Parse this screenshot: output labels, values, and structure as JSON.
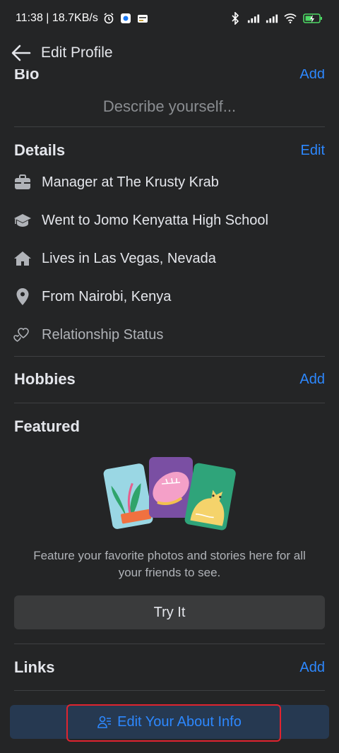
{
  "status_bar": {
    "time_info": "11:38 | 18.7KB/s"
  },
  "header": {
    "title": "Edit Profile"
  },
  "bio": {
    "title": "Bio",
    "action": "Add",
    "placeholder": "Describe yourself..."
  },
  "details": {
    "title": "Details",
    "action": "Edit",
    "items": [
      {
        "icon": "briefcase-icon",
        "text": "Manager at The Krusty Krab"
      },
      {
        "icon": "graduation-cap-icon",
        "text": "Went to Jomo Kenyatta High School"
      },
      {
        "icon": "home-icon",
        "text": "Lives in Las Vegas, Nevada"
      },
      {
        "icon": "location-pin-icon",
        "text": "From Nairobi, Kenya"
      },
      {
        "icon": "hearts-icon",
        "text": "Relationship Status"
      }
    ]
  },
  "hobbies": {
    "title": "Hobbies",
    "action": "Add"
  },
  "featured": {
    "title": "Featured",
    "caption": "Feature your favorite photos and stories here for all your friends to see.",
    "button": "Try It"
  },
  "links": {
    "title": "Links",
    "action": "Add"
  },
  "bottom": {
    "button": "Edit Your About Info"
  },
  "colors": {
    "background": "#242526",
    "accent": "#2d88ff",
    "highlight": "#e0242f"
  }
}
